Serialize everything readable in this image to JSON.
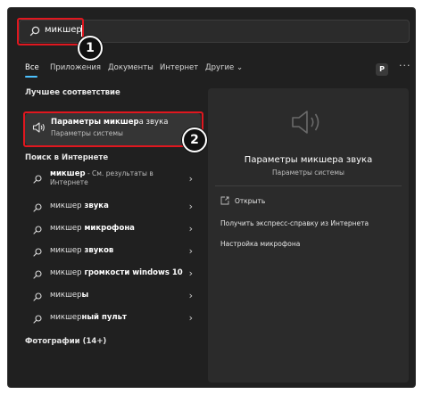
{
  "search": {
    "query": "микшер"
  },
  "tabs": [
    "Все",
    "Приложения",
    "Документы",
    "Интернет",
    "Другие"
  ],
  "user_initial": "P",
  "more": "···",
  "best_match": {
    "section": "Лучшее соответствие",
    "title_bold": "Параметры микшер",
    "title_rest": "а звука",
    "subtitle": "Параметры системы"
  },
  "web": {
    "section": "Поиск в Интернете",
    "items": [
      {
        "bold": "микшер",
        "rest": "",
        "note": " - См. результаты в",
        "note2": "Интернете"
      },
      {
        "bold": "микшер",
        "rest": " звука"
      },
      {
        "bold": "микшер",
        "rest": " микрофона"
      },
      {
        "bold": "микшер",
        "rest": " звуков"
      },
      {
        "bold": "микшер",
        "rest": " громкости windows 10"
      },
      {
        "bold": "микшер",
        "rest": "ы"
      },
      {
        "bold": "микшер",
        "rest": "ный пульт"
      }
    ]
  },
  "photos": {
    "section": "Фотографии (14+)"
  },
  "detail": {
    "title": "Параметры микшера звука",
    "subtitle": "Параметры системы",
    "actions": [
      "Открыть",
      "Получить экспресс-справку из Интернета",
      "Настройка микрофона"
    ]
  },
  "annotations": {
    "step1": "1",
    "step2": "2"
  },
  "colors": {
    "accent": "#4cc2ff",
    "highlight": "#e0171f",
    "panel": "#202020"
  }
}
